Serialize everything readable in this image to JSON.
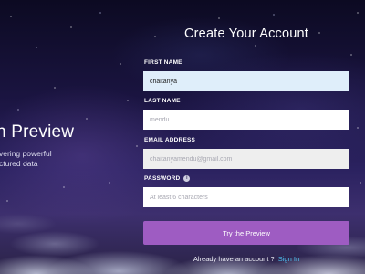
{
  "left_panel": {
    "title": "n Preview",
    "line1": "vering powerful",
    "line2": "ctured data"
  },
  "form": {
    "title": "Create Your Account",
    "fields": [
      {
        "label": "FIRST NAME",
        "value": "chaitanya",
        "placeholder": ""
      },
      {
        "label": "LAST NAME",
        "value": "",
        "placeholder": "mendu"
      },
      {
        "label": "EMAIL ADDRESS",
        "value": "",
        "placeholder": "chaitanyamendu@gmail.com"
      },
      {
        "label": "PASSWORD",
        "value": "",
        "placeholder": "At least 6 characters",
        "info_icon": "info-icon"
      }
    ],
    "submit_label": "Try the Preview",
    "signin_prompt": "Already have an account ?",
    "signin_link": "Sign In"
  },
  "colors": {
    "button": "#9e5cc2",
    "link": "#4fc1f0",
    "filled_input": "#dfeefa"
  }
}
